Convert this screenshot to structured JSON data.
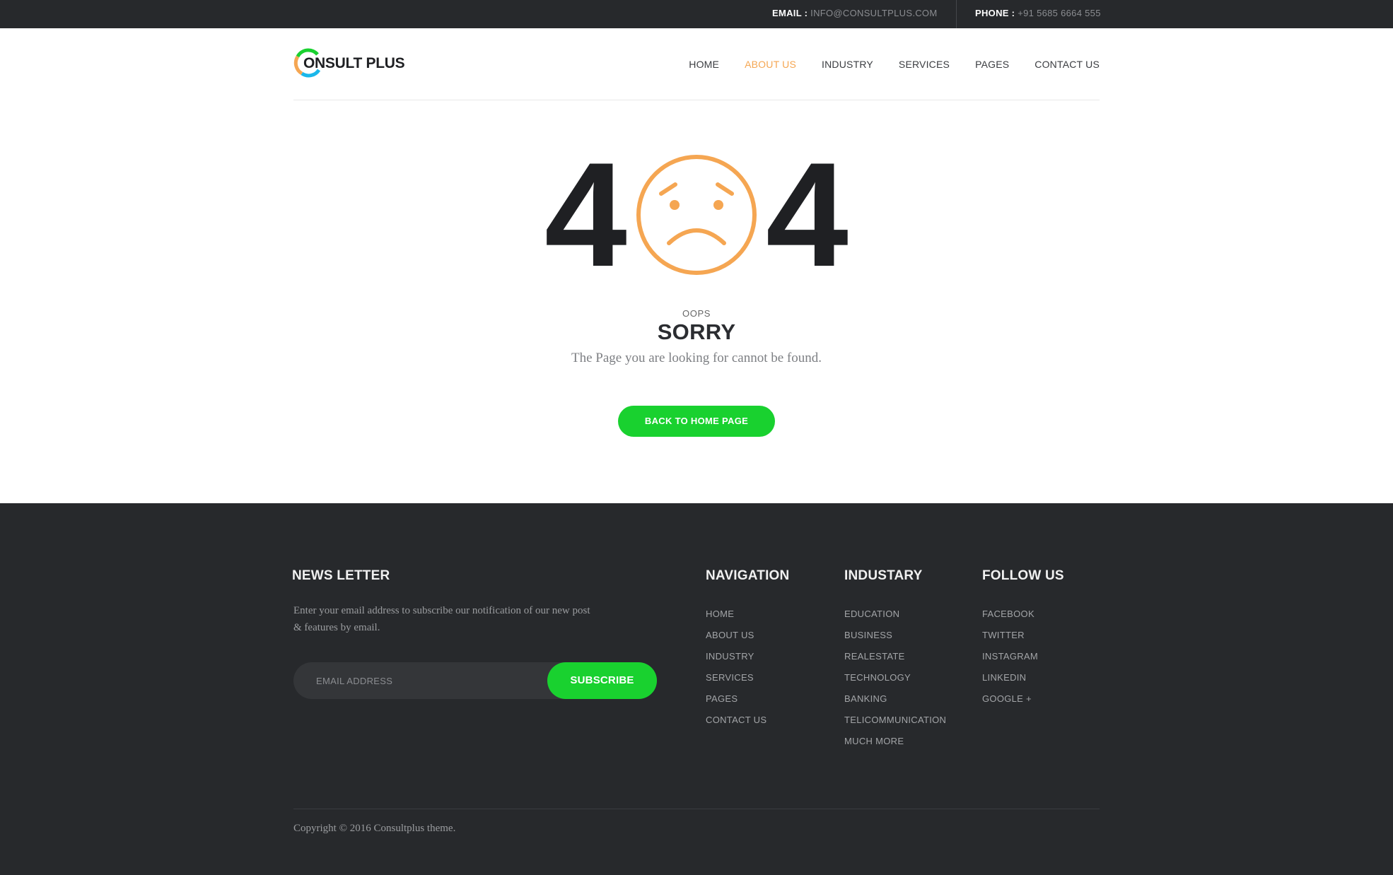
{
  "topbar": {
    "email_label": "EMAIL :",
    "email_value": "INFO@CONSULTPLUS.COM",
    "phone_label": "PHONE :",
    "phone_value": "+91 5685 6664 555"
  },
  "brand": {
    "name": "ONSULT PLUS",
    "colors": {
      "orange": "#f5a652",
      "green": "#19d12f",
      "blue": "#1ab7ea"
    }
  },
  "nav": [
    {
      "label": "HOME",
      "active": false
    },
    {
      "label": "ABOUT US",
      "active": true
    },
    {
      "label": "INDUSTRY",
      "active": false
    },
    {
      "label": "SERVICES",
      "active": false
    },
    {
      "label": "PAGES",
      "active": false
    },
    {
      "label": "CONTACT US",
      "active": false
    }
  ],
  "error": {
    "digit_left": "4",
    "digit_right": "4",
    "icon": "sad-face-icon",
    "oops": "OOPS",
    "title": "SORRY",
    "message": "The Page you are looking for cannot be found.",
    "button": "BACK TO HOME PAGE"
  },
  "footer": {
    "newsletter": {
      "heading": "NEWS LETTER",
      "text": "Enter your email address to subscribe our notification of our new post & features by email.",
      "placeholder": "EMAIL ADDRESS",
      "button": "SUBSCRIBE"
    },
    "navigation": {
      "heading": "NAVIGATION",
      "items": [
        "HOME",
        "ABOUT US",
        "INDUSTRY",
        "SERVICES",
        "PAGES",
        "CONTACT US"
      ]
    },
    "industry": {
      "heading": "INDUSTARY",
      "items": [
        "EDUCATION",
        "BUSINESS",
        "REALESTATE",
        "TECHNOLOGY",
        "BANKING",
        "TELICOMMUNICATION",
        "MUCH MORE"
      ]
    },
    "follow": {
      "heading": "FOLLOW US",
      "items": [
        "FACEBOOK",
        "TWITTER",
        "INSTAGRAM",
        "LINKEDIN",
        "GOOGLE +"
      ]
    },
    "copyright": "Copyright © 2016 Consultplus theme."
  },
  "colors": {
    "accent": "#f5a652",
    "button": "#19d12f",
    "dark": "#27292c"
  }
}
